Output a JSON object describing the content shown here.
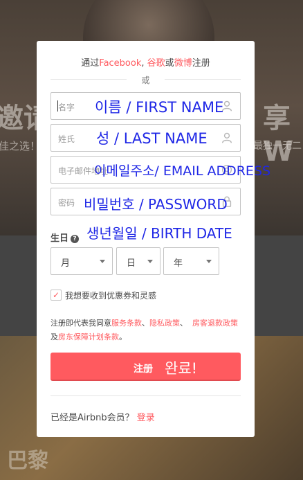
{
  "background": {
    "title_left": "邀请",
    "title_right": "享W",
    "subtitle_left": "佳之选！",
    "subtitle_right": "最独一无二",
    "city": "巴黎"
  },
  "modal": {
    "social": {
      "prefix": "通过",
      "facebook": "Facebook",
      "sep": ",",
      "google": "谷歌",
      "or_word": "或",
      "weibo": "微博",
      "suffix": "注册"
    },
    "or_divider": "或",
    "fields": {
      "first_name": {
        "placeholder": "名字",
        "overlay": "이름 / FIRST NAME",
        "icon": "user-icon"
      },
      "last_name": {
        "placeholder": "姓氏",
        "overlay": "성 / LAST NAME",
        "icon": "user-icon"
      },
      "email": {
        "placeholder": "电子邮件地址",
        "overlay": "이메일주소/ EMAIL ADDRESS",
        "icon": "email-icon"
      },
      "password": {
        "placeholder": "密码",
        "overlay": "비밀번호 / PASSWORD",
        "icon": "lock-icon"
      }
    },
    "birthday": {
      "label": "生日",
      "help": "?",
      "overlay": "생년월일 / BIRTH DATE",
      "month": "月",
      "day": "日",
      "year": "年"
    },
    "promo_checkbox": {
      "label": "我想要收到优惠券和灵感",
      "checked": true
    },
    "terms": {
      "prefix": "注册即代表我同意",
      "service": "服务条款",
      "sep1": "、",
      "privacy": "隐私政策",
      "sep2": "、",
      "guest_refund": "房客退款政策",
      "and": "及",
      "host_guarantee": "房东保障计划条款",
      "end": "。"
    },
    "signup_button": {
      "label": "注册",
      "overlay": "완료!"
    },
    "member": {
      "text": "已经是Airbnb会员？",
      "login": "登录"
    }
  },
  "colors": {
    "brand": "#ff5a5f",
    "overlay_text": "#1f27e6"
  }
}
